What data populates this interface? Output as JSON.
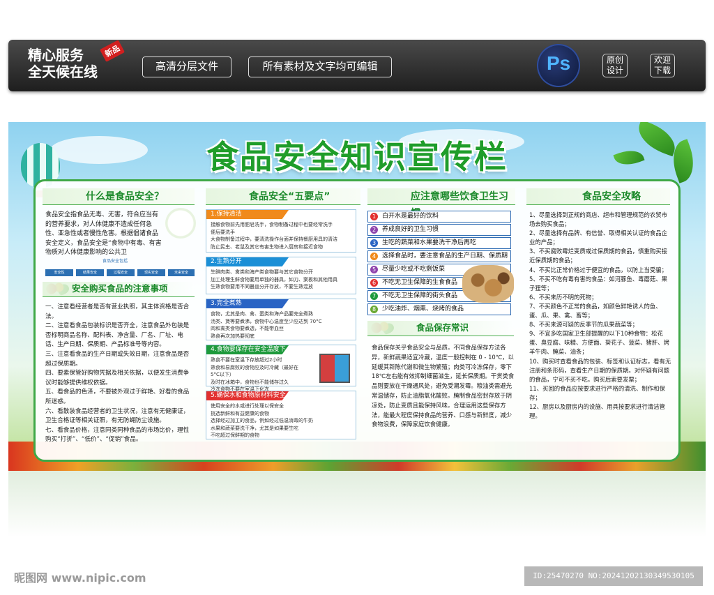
{
  "banner": {
    "brand_line1": "精心服务",
    "brand_line2": "全天候在线",
    "badge": "新品",
    "pill1": "高清分层文件",
    "pill2": "所有素材及文字均可编辑",
    "ps": "Ps",
    "btn1": "原创\n设计",
    "btn2": "欢迎\n下载"
  },
  "poster": {
    "title": "食品安全知识宣传栏",
    "col1": {
      "head": "什么是食品安全？",
      "intro": "食品安全指食品无毒、无害，符合应当有的营养要求，对人体健康不造成任何急性、亚急性或者慢性危害。根据倡诸食品安全定义，食品安全是“食物中有毒、有害物质对人体健康影响的公共卫",
      "tree_root": "食品安全包括",
      "tree_nodes": [
        "安全性",
        "结果安全",
        "过程安全",
        "现实安全",
        "未来安全"
      ],
      "sub": "安全购买食品的注意事项",
      "body": "一、注意看经营者是否有营业执照，其主体资格是否合法。\n二、注意看食品包装标识是否齐全，注意食品外包装是否标明商品名称、配料表、净含量、厂名、厂址、电话、生产日期、保质期、产品标准号等内容。\n三、注意看食品的生产日期或失效日期，注意食品是否超过保质期。\n四、要素保管好购物凭据及相关依据，以便发生消费争议时能够提供维权依据。\n五、看食品的色泽，不要被外观过于鲜艳、好看的食品所迷惑。\n六、看散装食品经营者的卫生状况，注意有无健康证，卫生合格证等相关证照，有无防蝇防尘设施。\n七、看食品价格，注意同类同种食品的市场比价，理性购买“打折”、“低价”、“促销”食品。"
    },
    "col2": {
      "head": "食品安全“五要点”",
      "cards": [
        {
          "title": "1.保持清洁",
          "color": "#f08a1c",
          "body": "接触食物前先用肥皂洗手，食物制备过程中也要经常洗手\n便后要洗手\n大食物制备过程中，要清洗操作台面并保持餐厨用具的清洁\n防止民虫、老鼠及其它有害生物进入厨房和接近食物"
        },
        {
          "title": "2.生熟分开",
          "color": "#1b8fd6",
          "body": "生鲜肉类、禽类和海产类食物要与其它食物分开\n加工处理生鲜食物要用单独的器具，如刀、案板和其他用具\n生熟食物要用不同器皿分开存放，不要生熟混放"
        },
        {
          "title": "3.完全煮熟",
          "color": "#2a64c4",
          "body": "食物，尤其是肉、禽、蛋类和海产品要完全煮熟\n汤类、煲等要煮沸，食物中心温度至少应达到 70°C\n肉和禽类食物要煮透，不能带血丝\n熟食再次加热要彻底"
        },
        {
          "title": "4.食物要保存在安全温度下",
          "color": "#1e9a3c",
          "body": "熟食不要在室温下存放超过2小时\n熟食和易腐败的食物应及时冷藏（最好在5°C以下）\n及时在冰箱中，食物也不能储存过久\n冷冻食物不要在室温下化冻"
        },
        {
          "title": "5.确保水和食物原材料安全",
          "color": "#e2302f",
          "body": "使用安全的水或进行处理以保安全\n挑选新鲜和有益健康的食物\n选择经过加工的食品，例如经过低温消毒的牛奶\n水果和蔬菜要洗干净，尤其是如果要生吃\n不吃超过保鲜期的食物"
        }
      ]
    },
    "col3": {
      "head": "应注意哪些饮食卫生习惯",
      "habits": [
        {
          "n": "1",
          "text": "白开水是最好的饮料",
          "color": "#e2302f"
        },
        {
          "n": "2",
          "text": "养成良好的卫生习惯",
          "color": "#8e44ad"
        },
        {
          "n": "3",
          "text": "生吃的蔬菜和水果要洗干净后再吃",
          "color": "#2a64c4"
        },
        {
          "n": "4",
          "text": "选择食品时，要注意食品的生产日期、保质期",
          "color": "#f08a1c"
        },
        {
          "n": "5",
          "text": "尽量少吃或不吃剩饭菜",
          "color": "#8e44ad"
        },
        {
          "n": "6",
          "text": "不吃无卫生保障的生食食品",
          "color": "#e2302f"
        },
        {
          "n": "7",
          "text": "不吃无卫生保障的街头食品",
          "color": "#1e9a3c"
        },
        {
          "n": "8",
          "text": "少吃油炸、烟熏、烧烤的食品",
          "color": "#6aa935"
        }
      ],
      "sub": "食品保存常识",
      "body": "食品保存关乎食品安全与品质。不同食品保存方法各异，新鲜蔬果适宜冷藏，温度一般控制在 0 - 10℃，以延缓其新陈代谢和微生物繁殖；肉类可冷冻保存，零下 18℃左右能有效抑制细菌滋生，延长保质期。干货类食品则要放在干燥通风处，避免受潮发霉。粮油类需避光常温储存，防止油脂氧化酸败。腌制食品密封存放于阴凉处，防止变质且能保持风味。合理运用这些保存方法，能最大程度保持食品的营养、口感与新鲜度，减少食物浪费，保障家庭饮食健康。"
    },
    "col4": {
      "head": "食品安全攻略",
      "body": "1、尽量选择到正规的商店、超市和管理规范的农贸市场去购买食品；\n2、尽量选择有品牌、有信誉、取得相关认证的食品企业的产品；\n3、不买腐败霉烂变质或过保质期的食品，慎重购买接近保质期的食品；\n4、不买比正常价格过于便宜的食品，以防上当受骗；\n5、不买不吃有毒有害的食品：如河豚鱼、毒蘑菇、果子狸等；\n6、不买来历不明的死物；\n7、不买颜色不正常的食品，如颜色鲜艳诱人的鱼、蛋、瓜、果、禽、畜等；\n8、不买来源可疑的反季节的瓜果蔬菜等；\n9、不宜多吃国家卫生部提醒的以下10种食物：松花蛋、臭豆腐、味精、方便面、葵花子、菠菜、猪肝、烤羊牛肉、腌菜、油条；\n10、购买时查看食品的包装、标签和认证标志，看有无注册和条形码，查看生产日期的保质期。对怀疑有问题的食品，宁可不买不吃。购买后索要发票；\n11、买回的食品应按要求进行严格的清洗、制作和保存；\n12、厨房以及厨房内的设施、用具按要求进行清洁管理。"
    }
  },
  "footer": {
    "watermark": "昵图网 www.nipic.com",
    "id": "ID:25470270 NO:20241202130349530105"
  }
}
